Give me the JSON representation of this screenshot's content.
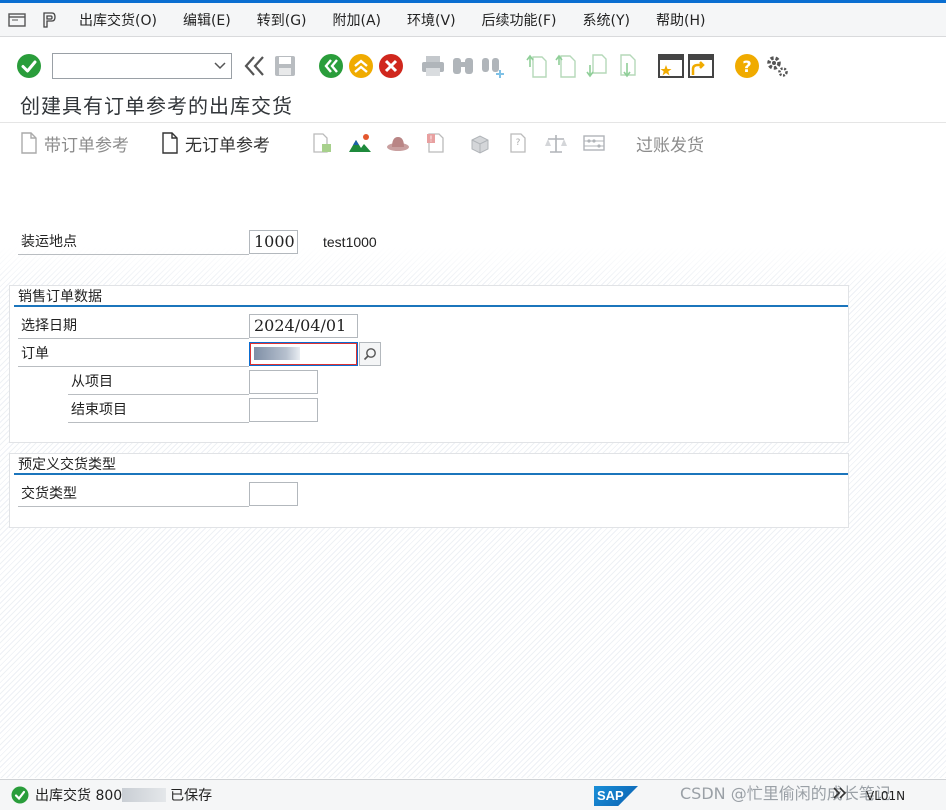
{
  "menubar": {
    "items": [
      {
        "label": "出库交货(O)"
      },
      {
        "label": "编辑(E)"
      },
      {
        "label": "转到(G)"
      },
      {
        "label": "附加(A)"
      },
      {
        "label": "环境(V)"
      },
      {
        "label": "后续功能(F)"
      },
      {
        "label": "系统(Y)"
      },
      {
        "label": "帮助(H)"
      }
    ]
  },
  "toolbar": {
    "command_value": "",
    "icons": [
      "enter-icon",
      "back-chevrons-icon",
      "save-icon",
      "back-icon",
      "exit-icon",
      "cancel-icon",
      "print-icon",
      "find-icon",
      "find-next-icon",
      "first-page-icon",
      "previous-page-icon",
      "next-page-icon",
      "last-page-icon",
      "create-session-icon",
      "shortcut-icon",
      "help-icon",
      "settings-gear-icon"
    ]
  },
  "page": {
    "title": "创建具有订单参考的出库交货"
  },
  "app_toolbar": {
    "with_order_ref": "带订单参考",
    "without_order_ref": "无订单参考",
    "post_goods_issue": "过账发货"
  },
  "form": {
    "shipping_point_label": "装运地点",
    "shipping_point_value": "1000",
    "shipping_point_desc": "test1000",
    "sales_order_group_title": "销售订单数据",
    "selection_date_label": "选择日期",
    "selection_date_value": "2024/04/01",
    "order_label": "订单",
    "from_item_label": "从项目",
    "from_item_value": "",
    "to_item_label": "结束项目",
    "to_item_value": "",
    "delivery_type_group_title": "预定义交货类型",
    "delivery_type_label": "交货类型",
    "delivery_type_value": ""
  },
  "status": {
    "prefix": "出库交货 800",
    "suffix": "已保存",
    "sap_logo": "SAP",
    "transaction": "VL01N",
    "watermark": "CSDN @忙里偷闲的成长笔记"
  },
  "colors": {
    "accent": "#0a6ed1",
    "ok_green": "#2a9d3b",
    "error_red": "#d0271d",
    "help_orange": "#f0ab00"
  }
}
